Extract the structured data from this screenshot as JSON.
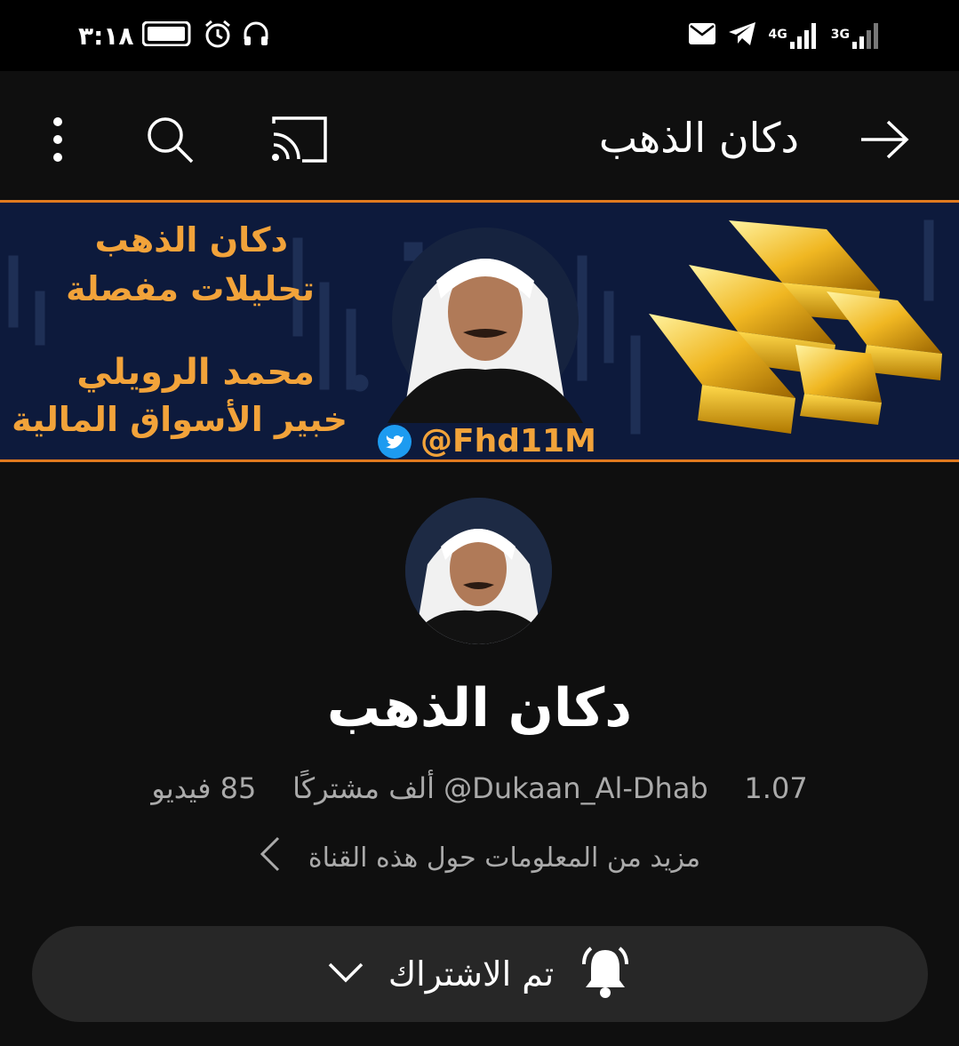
{
  "status_bar": {
    "time": "٣:١٨",
    "net1": "4G",
    "net2": "3G",
    "icons": [
      "battery-icon",
      "alarm-icon",
      "headphones-icon",
      "mail-icon",
      "telegram-icon",
      "signal-icon"
    ]
  },
  "top_bar": {
    "title": "دكان الذهب",
    "icons": [
      "back-arrow-icon",
      "cast-icon",
      "search-icon",
      "more-vert-icon"
    ]
  },
  "banner": {
    "line1": "دكان الذهب",
    "line2": "تحليلات مفصلة",
    "line3": "محمد الرويلي",
    "line4": "خبير الأسواق المالية",
    "handle": "@Fhd11M",
    "accent": "#e07a1f"
  },
  "channel": {
    "name": "دكان الذهب",
    "handle": "@Dukaan_Al-Dhab",
    "subscribers": "1.07 ألف مشتركًا",
    "videos": "85 فيديو",
    "more_info": "مزيد من المعلومات حول هذه القناة"
  },
  "subscribe": {
    "label": "تم الاشتراك"
  }
}
